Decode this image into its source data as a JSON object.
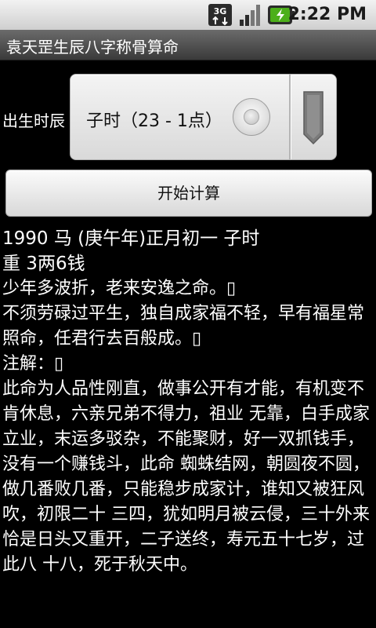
{
  "status_bar": {
    "network": "3G",
    "time": "2:22 PM"
  },
  "app": {
    "title": "袁天罡生辰八字称骨算命"
  },
  "spinner": {
    "label": "出生时辰",
    "selected": "子时（23 - 1点）"
  },
  "start_button": {
    "label": "开始计算"
  },
  "result": {
    "lines": [
      "1990 马 (庚午年)正月初一  子时",
      "重 3两6钱",
      "少年多波折，老来安逸之命。▯",
      "不须劳碌过平生，独自成家福不轻，早有福星常照命，任君行去百般成。▯",
      "注解：▯",
      "此命为人品性刚直，做事公开有才能，有机变不肯休息，六亲兄弟不得力，祖业 无靠，白手成家立业，末运多驳杂，不能聚财，好一双抓钱手，没有一个赚钱斗，此命 蜘蛛结网，朝圆夜不圆，做几番败几番，只能稳步成家计，谁知又被狂风吹，初限二十 三四，犹如明月被云侵，三十外来恰是日头又重开，二子送终，寿元五十七岁，过此八 十八，死于秋天中。"
    ]
  },
  "colors": {
    "background": "#000000",
    "text": "#ffffff",
    "battery_accent": "#4caf1a"
  }
}
